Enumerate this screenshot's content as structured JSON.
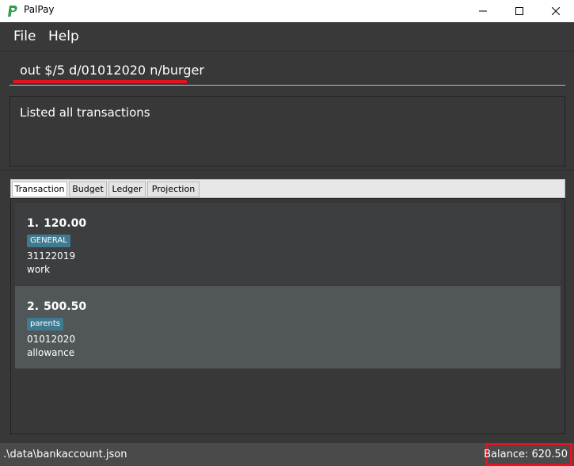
{
  "window": {
    "title": "PalPay"
  },
  "menu": {
    "file": "File",
    "help": "Help"
  },
  "command": {
    "value": "out $/5 d/01012020 n/burger"
  },
  "result": {
    "message": "Listed all transactions"
  },
  "tabs": [
    {
      "label": "Transaction"
    },
    {
      "label": "Budget"
    },
    {
      "label": "Ledger"
    },
    {
      "label": "Projection"
    }
  ],
  "transactions": [
    {
      "index": "1.",
      "amount": "120.00",
      "tag": "GENERAL",
      "date": "31122019",
      "description": "work"
    },
    {
      "index": "2.",
      "amount": "500.50",
      "tag": "parents",
      "date": "01012020",
      "description": "allowance"
    }
  ],
  "status": {
    "path": ".\\data\\bankaccount.json",
    "balance": "Balance: 620.50"
  },
  "colors": {
    "accent_red": "#e3131f",
    "tag_bg": "#3e7b91",
    "background": "#383838"
  }
}
